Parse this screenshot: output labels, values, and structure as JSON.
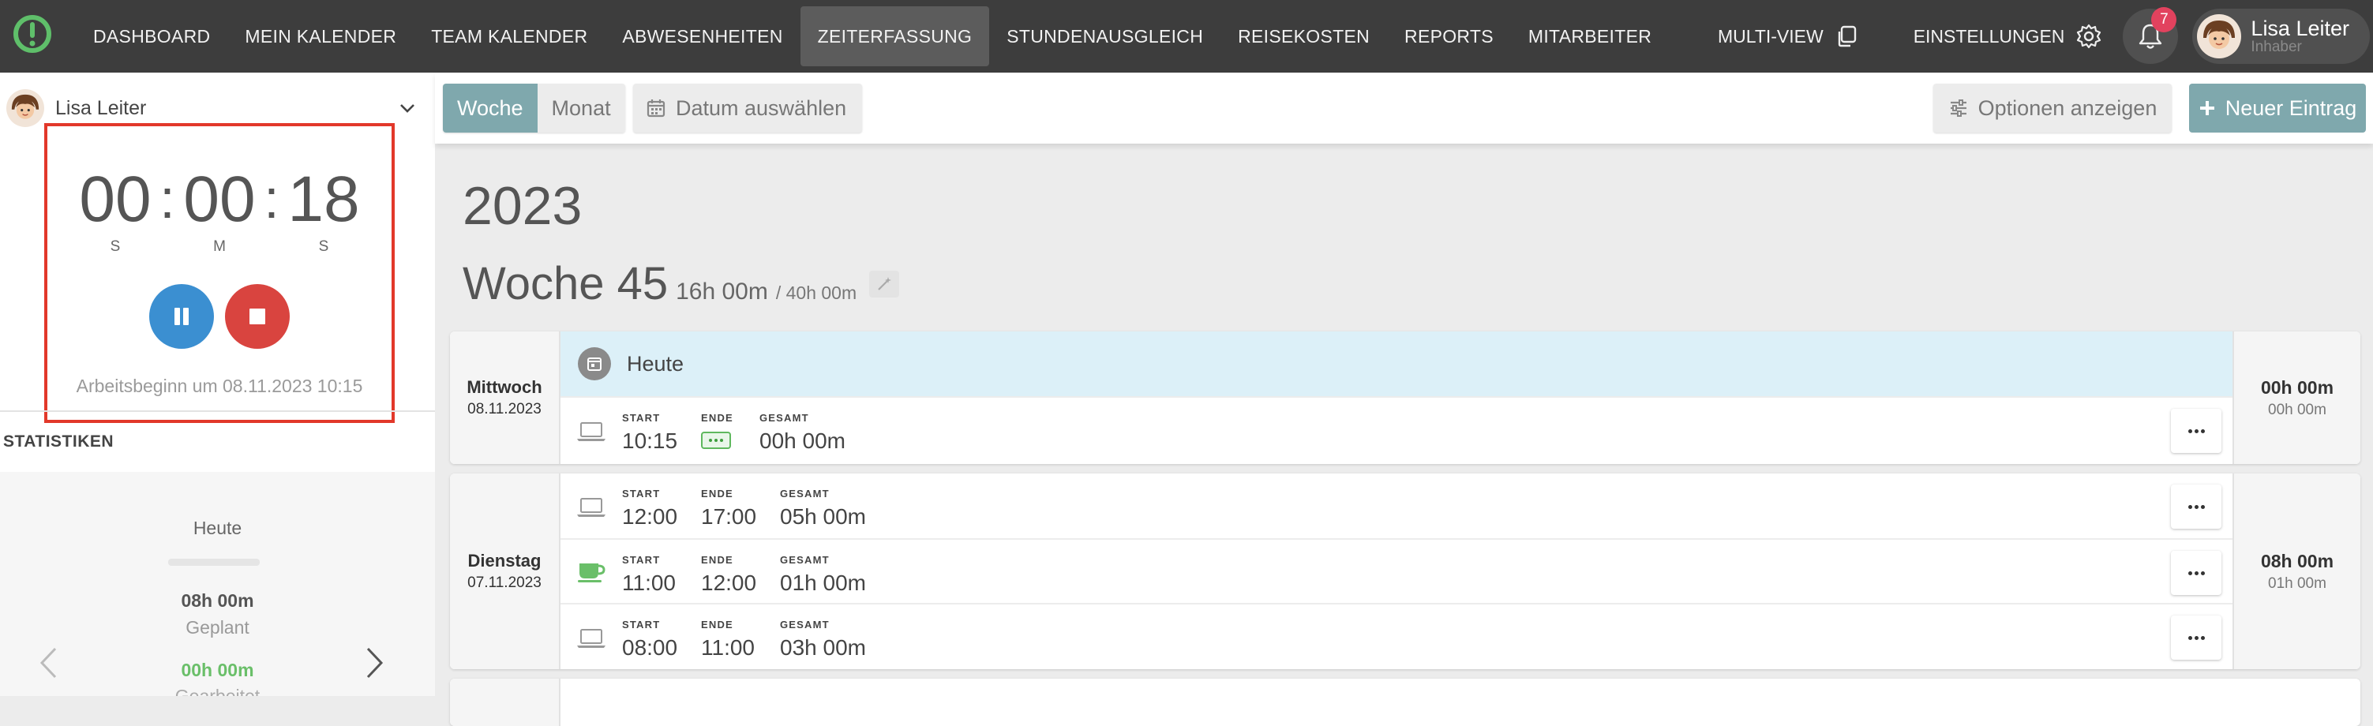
{
  "nav": {
    "items": [
      "DASHBOARD",
      "MEIN KALENDER",
      "TEAM KALENDER",
      "ABWESENHEITEN",
      "ZEITERFASSUNG",
      "STUNDENAUSGLEICH",
      "REISEKOSTEN",
      "REPORTS",
      "MITARBEITER"
    ],
    "active": "ZEITERFASSUNG",
    "multiview": "MULTI-VIEW",
    "settings": "EINSTELLUNGEN",
    "notification_count": "7",
    "user_name": "Lisa Leiter",
    "user_role": "Inhaber"
  },
  "colors": {
    "accent": "#7fa8ad",
    "topbar": "#3d3d3d",
    "highlight_border": "#e2382a",
    "pause": "#3b8fd1",
    "stop": "#d9443f",
    "worked": "#6abf69"
  },
  "sidebar": {
    "user_name": "Lisa Leiter",
    "timer": {
      "h": "00",
      "m": "00",
      "s": "18",
      "h_label": "S",
      "m_label": "M",
      "s_label": "S"
    },
    "work_start": "Arbeitsbeginn um 08.11.2023 10:15",
    "stats_title": "STATISTIKEN",
    "stats": {
      "period": "Heute",
      "planned_value": "08h 00m",
      "planned_label": "Geplant",
      "worked_value": "00h 00m",
      "worked_label": "Gearbeitet"
    }
  },
  "toolbar": {
    "view_week": "Woche",
    "view_month": "Monat",
    "date_picker": "Datum auswählen",
    "options": "Optionen anzeigen",
    "new_entry": "Neuer Eintrag"
  },
  "main": {
    "year": "2023",
    "week_title": "Woche 45",
    "week_hours": "16h 00m",
    "week_target": "/ 40h 00m",
    "days": [
      {
        "name": "Mittwoch",
        "date": "08.11.2023",
        "total": "00h 00m",
        "sub": "00h 00m",
        "banner": "Heute",
        "entries": [
          {
            "type": "work",
            "start_label": "START",
            "start": "10:15",
            "end_label": "ENDE",
            "end": "",
            "total_label": "GESAMT",
            "total": "00h 00m"
          }
        ]
      },
      {
        "name": "Dienstag",
        "date": "07.11.2023",
        "total": "08h 00m",
        "sub": "01h 00m",
        "entries": [
          {
            "type": "work",
            "start_label": "START",
            "start": "12:00",
            "end_label": "ENDE",
            "end": "17:00",
            "total_label": "GESAMT",
            "total": "05h 00m"
          },
          {
            "type": "break",
            "start_label": "START",
            "start": "11:00",
            "end_label": "ENDE",
            "end": "12:00",
            "total_label": "GESAMT",
            "total": "01h 00m"
          },
          {
            "type": "work",
            "start_label": "START",
            "start": "08:00",
            "end_label": "ENDE",
            "end": "11:00",
            "total_label": "GESAMT",
            "total": "03h 00m"
          }
        ]
      }
    ]
  }
}
